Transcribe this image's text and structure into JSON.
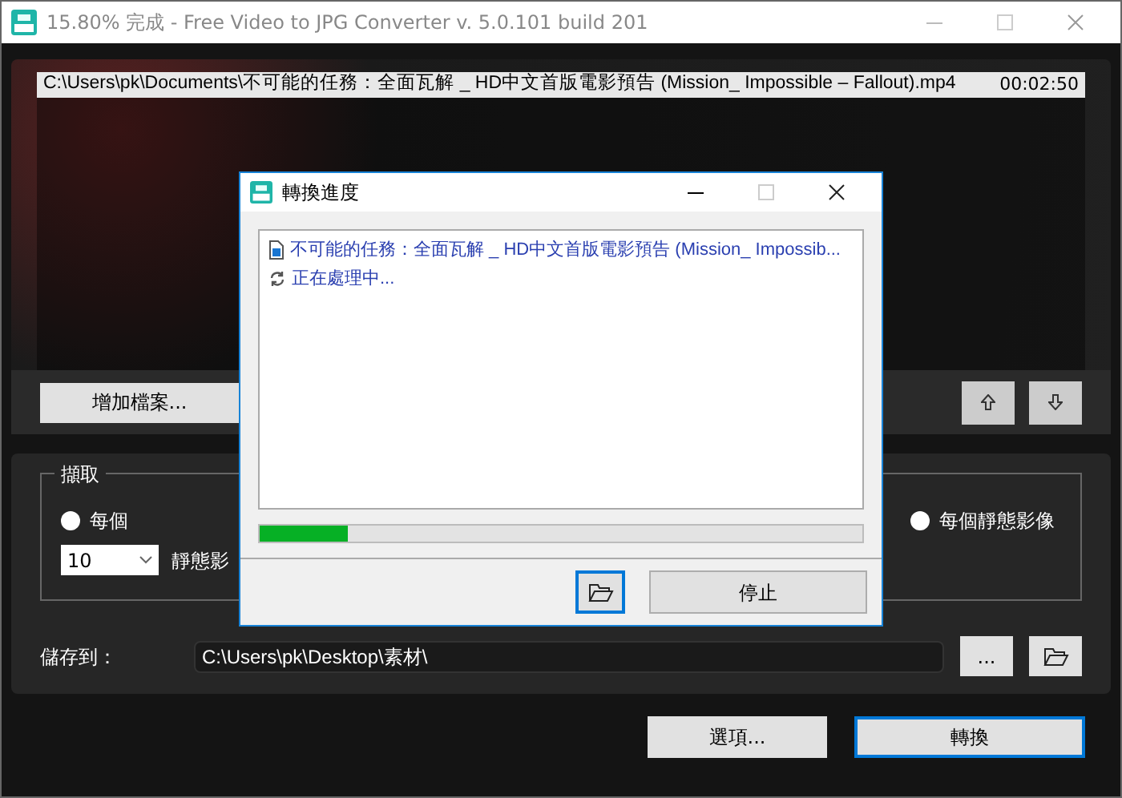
{
  "window": {
    "title": "15.80% 完成 - Free Video to JPG Converter  v. 5.0.101 build 201"
  },
  "file_list": {
    "rows": [
      {
        "path": "C:\\Users\\pk\\Documents\\不可能的任務：全面瓦解 _ HD中文首版電影預告 (Mission_ Impossible – Fallout).mp4",
        "duration": "00:02:50",
        "selected": true
      }
    ]
  },
  "add_files_button": "增加檔案...",
  "extract_group": {
    "legend": "擷取",
    "radios": [
      {
        "label": "每個",
        "selected": false
      },
      {
        "label": "每個靜態影像",
        "selected": false
      }
    ],
    "count": "10",
    "count_suffix": "靜態影"
  },
  "save_to": {
    "label": "儲存到：",
    "path": "C:\\Users\\pk\\Desktop\\素材\\",
    "browse_button": "..."
  },
  "buttons": [
    "選項...",
    "轉換"
  ],
  "dialog": {
    "title": "轉換進度",
    "log": [
      {
        "kind": "file",
        "text": "不可能的任務：全面瓦解 _ HD中文首版電影預告 (Mission_ Impossib..."
      },
      {
        "kind": "status",
        "text": "正在處理中..."
      }
    ],
    "progress": {
      "level": 0.145
    },
    "stop_button": "停止"
  }
}
